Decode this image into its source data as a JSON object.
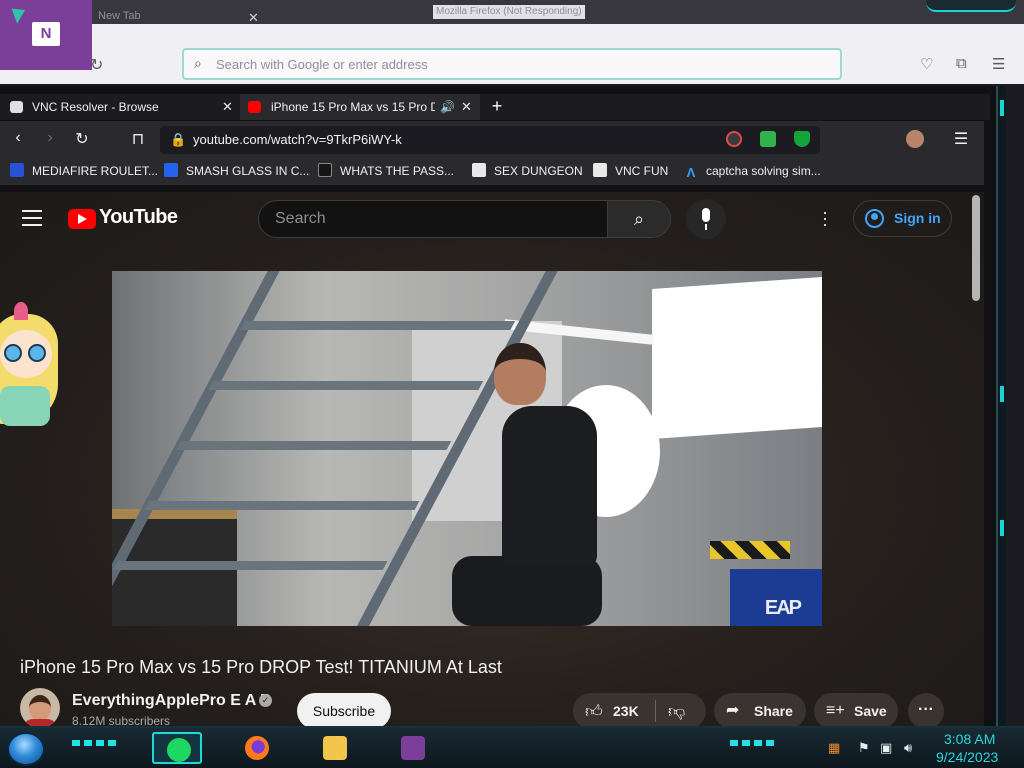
{
  "background_window": {
    "title": "Mozilla Firefox (Not Responding)",
    "tab_label": "New Tab",
    "search_placeholder": "Search with Google or enter address"
  },
  "tabs": [
    {
      "label": "VNC Resolver - Browse",
      "active": false
    },
    {
      "label": "iPhone 15 Pro Max vs 15 Pro D",
      "active": true
    }
  ],
  "address": {
    "url": "youtube.com/watch?v=9TkrP6iWY-k"
  },
  "bookmarks": [
    {
      "label": "MEDIAFIRE ROULET...",
      "icon": "mediafire-icon",
      "color": "#2752d6"
    },
    {
      "label": "SMASH GLASS IN C...",
      "icon": "glass-icon",
      "color": "#2563eb"
    },
    {
      "label": "WHATS THE PASS...",
      "icon": "page-icon",
      "color": "#151515"
    },
    {
      "label": "SEX DUNGEON",
      "icon": "vnc-icon",
      "color": "#ffffff"
    },
    {
      "label": "VNC FUN",
      "icon": "vnc-icon",
      "color": "#ffffff"
    },
    {
      "label": "captcha solving sim...",
      "icon": "lambda-icon",
      "color": "#2ea2ff"
    }
  ],
  "youtube": {
    "logo_text": "YouTube",
    "search_placeholder": "Search",
    "signin_label": "Sign in",
    "video_title": "iPhone 15 Pro Max vs 15 Pro DROP Test! TITANIUM At Last",
    "watermark": "EAP",
    "channel_name": "EverythingApplePro E A P",
    "subscribers": "8.12M subscribers",
    "subscribe_label": "Subscribe",
    "like_count": "23K",
    "share_label": "Share",
    "save_label": "Save"
  },
  "taskbar": {
    "time": "3:08 AM",
    "date": "9/24/2023",
    "accent": "#21e3e6"
  },
  "colors": {
    "youtube_red": "#ff0000",
    "signin_blue": "#3ea6ff",
    "onenote_purple": "#7b3f9a"
  }
}
